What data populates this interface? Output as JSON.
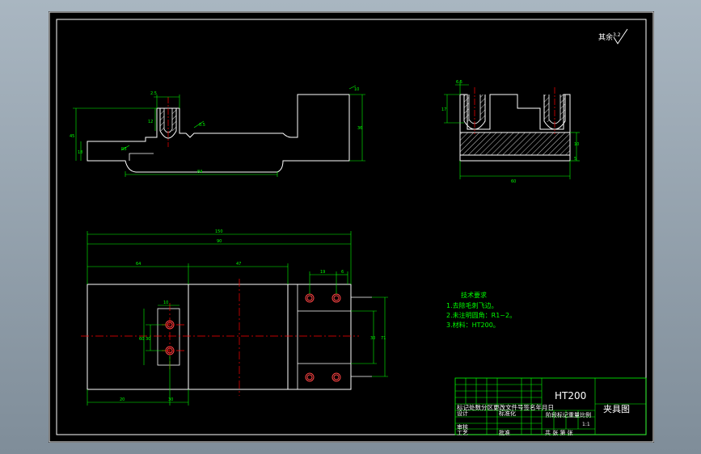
{
  "colors": {
    "sheet": "#000000",
    "outline": "#ffffff",
    "dimension": "#00ff00",
    "centerline": "#ff0000",
    "hatch": "#ffffff"
  },
  "drawing": {
    "roughness_note": "其余",
    "roughness_value": "3.2",
    "dims_front": {
      "top_slot_w": "2.5",
      "slot_depth": "12",
      "chamfer": "0.5",
      "total_h": "45",
      "step_h": "18",
      "base_h": "15",
      "fillet": "R5",
      "bottom_len": "84",
      "right_h": "36",
      "right_top": "10"
    },
    "dims_side": {
      "slot_w": "6.5",
      "slot_h": "17",
      "width": "60",
      "base_h": "10",
      "base_t": "5"
    },
    "dims_top": {
      "total_len": "150",
      "len_90": "90",
      "len_left": "64",
      "len_mid": "47",
      "hole_spacing": "30",
      "hole_off": "10",
      "hole_pitch": "19",
      "hole_gap": "6",
      "side_h": "60",
      "bottom_left": "20",
      "bottom_mid": "30",
      "right_span": "71",
      "right_inner": "30"
    }
  },
  "tech_req": {
    "title": "技术要求",
    "items": [
      "1.去除毛刺飞边。",
      "2.未注明圆角：R1~2。",
      "3.材料：HT200。"
    ]
  },
  "title_block": {
    "material": "HT200",
    "drawing_name": "夹具图",
    "revision_row": "标记处数分区更改文件号签名年月日",
    "design": "设计",
    "standardize": "标准化",
    "stage_label": "阶段标记重量比例",
    "scale": "1:1",
    "review": "审核",
    "process": "工艺",
    "approve": "批准",
    "sheets": "共 张 第 张"
  }
}
